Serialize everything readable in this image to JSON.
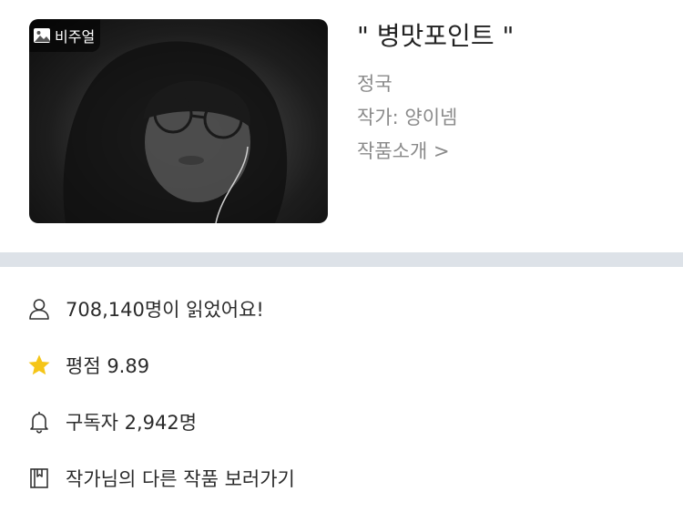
{
  "work": {
    "visual_badge": "비주얼",
    "title": "\" 병맛포인트 \"",
    "genre": "정국",
    "author": "작가: 양이넴",
    "intro_link": "작품소개 >"
  },
  "stats": {
    "readers": "708,140명이 읽었어요!",
    "rating": "평점 9.89",
    "subscribers": "구독자 2,942명",
    "other_works": "작가님의 다른 작품 보러가기"
  },
  "icons": {
    "badge": "image-icon",
    "readers": "person-icon",
    "rating": "star-icon",
    "subscribers": "bell-icon",
    "other_works": "book-icon"
  },
  "colors": {
    "star": "#f5c518",
    "divider": "#dde2e8",
    "muted_text": "#8a8a8a"
  }
}
